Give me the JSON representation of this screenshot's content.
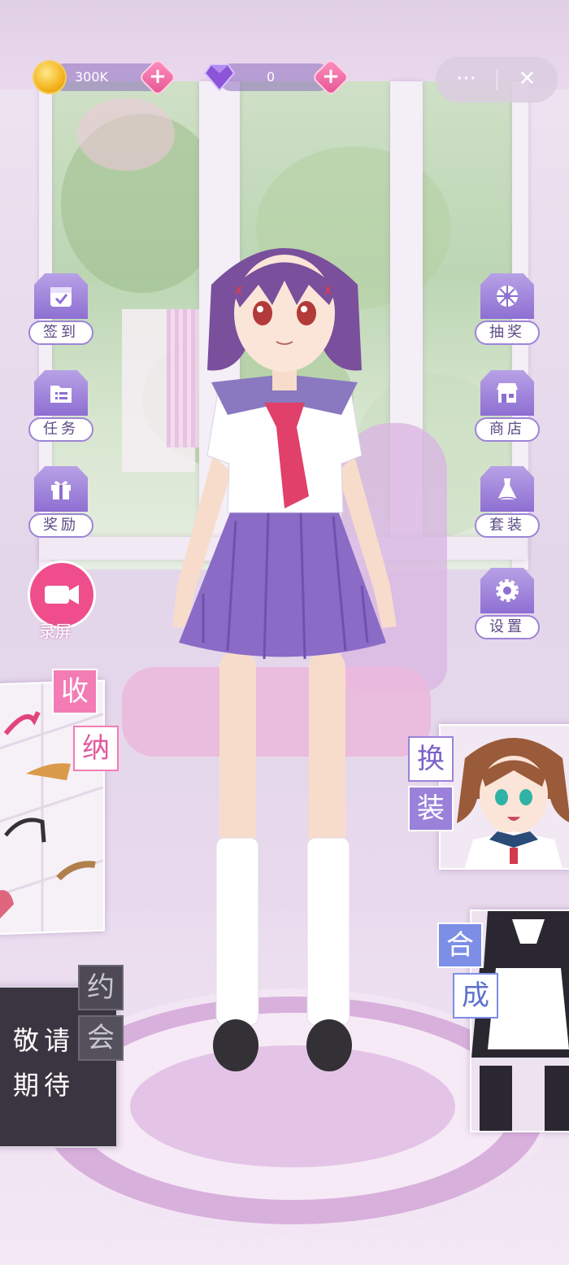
{
  "hud": {
    "coins": "300K",
    "gems": "0",
    "capsule_more": "···",
    "capsule_close": "✕"
  },
  "left_menu": [
    {
      "label": "签到",
      "icon": "calendar-check-icon"
    },
    {
      "label": "任务",
      "icon": "task-folder-icon"
    },
    {
      "label": "奖励",
      "icon": "gift-icon"
    }
  ],
  "right_menu": [
    {
      "label": "抽奖",
      "icon": "lottery-wheel-icon"
    },
    {
      "label": "商店",
      "icon": "shop-icon"
    },
    {
      "label": "套装",
      "icon": "dress-icon"
    },
    {
      "label": "设置",
      "icon": "gear-icon"
    }
  ],
  "record": {
    "label": "录屏"
  },
  "storage": {
    "tag1": "收",
    "tag2": "纳"
  },
  "dressup": {
    "tag1": "换",
    "tag2": "装"
  },
  "synthesis": {
    "tag1": "合",
    "tag2": "成"
  },
  "date": {
    "tag1": "约",
    "tag2": "会",
    "coming_line1": "敬请",
    "coming_line2": "期待"
  },
  "colors": {
    "accent_pink": "#f37cb5",
    "accent_purple": "#9a82da",
    "accent_blue": "#7d8ee6"
  }
}
